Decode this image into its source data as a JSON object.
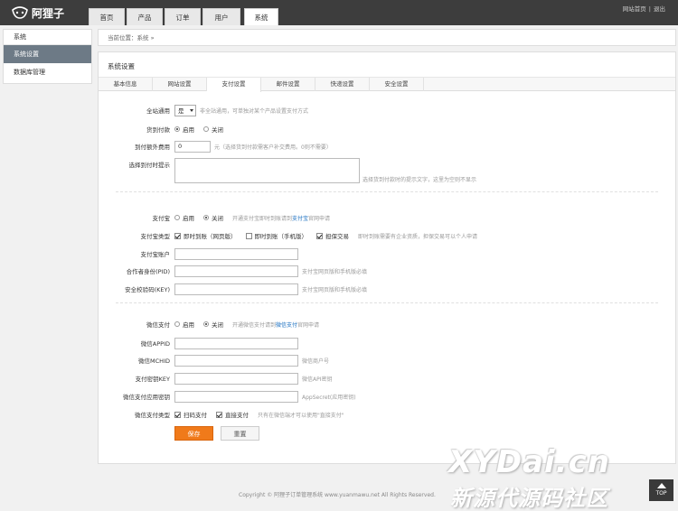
{
  "app": {
    "logo_text": "阿狸子"
  },
  "nav": {
    "tabs": [
      "首页",
      "产品",
      "订单",
      "用户",
      "系统"
    ],
    "active": "系统"
  },
  "top_links": {
    "site_home": "网站首页",
    "separator": "|",
    "logout": "退出"
  },
  "sidebar": {
    "title": "系统",
    "items": [
      "系统设置",
      "数据库管理"
    ]
  },
  "breadcrumb": "当前位置：系统 »",
  "panel": {
    "title": "系统设置",
    "tabs": [
      "基本信息",
      "网站设置",
      "支付设置",
      "邮件设置",
      "快递设置",
      "安全设置"
    ],
    "active_tab": "支付设置"
  },
  "form": {
    "global": {
      "label": "全站通用",
      "select_value": "是",
      "hint": "非全站通用，可单独对某个产品设置支付方式"
    },
    "cod": {
      "label": "货到付款",
      "enable": "启用",
      "disable": "关闭"
    },
    "cod_fee": {
      "label": "到付额外费用",
      "value": "0",
      "hint": "元（选择货到付款需客户补交费用。0则不需要）"
    },
    "cod_tip": {
      "label": "选择到付时提示",
      "hint": "选择货到付款时的提示文字，这里为空则不显示"
    },
    "alipay": {
      "label": "支付宝",
      "enable": "启用",
      "disable": "关闭",
      "hint_pre": "开通支付宝即时到账请到",
      "hint_link": "支付宝",
      "hint_post": "官网申请"
    },
    "alipay_type": {
      "label": "支付宝类型",
      "opt1": "即时到账（网页版）",
      "opt2": "即时到账（手机版）",
      "opt3": "担保交易",
      "hint": "即时到账需要有企业资质，担保交易可以个人申请"
    },
    "alipay_account": {
      "label": "支付宝账户"
    },
    "partner_id": {
      "label": "合作者身份(PID)",
      "hint": "支付宝网页版和手机版必填"
    },
    "alipay_key": {
      "label": "安全校验码(KEY)",
      "hint": "支付宝网页版和手机版必填"
    },
    "wechat": {
      "label": "微信支付",
      "enable": "启用",
      "disable": "关闭",
      "hint_pre": "开通微信支付请到",
      "hint_link": "微信支付",
      "hint_post": "官网申请"
    },
    "wechat_appid": {
      "label": "微信APPID"
    },
    "wechat_mchid": {
      "label": "微信MCHID",
      "hint": "微信商户号"
    },
    "wechat_key": {
      "label": "支付密钥KEY",
      "hint": "微信API密钥"
    },
    "wechat_secret": {
      "label": "微信支付应用密钥",
      "hint": "AppSecret(应用密钥)"
    },
    "wechat_type": {
      "label": "微信支付类型",
      "opt1": "扫码支付",
      "opt2": "直接支付",
      "hint": "只有在微信端才可以使用\"直接支付\""
    },
    "save": "保存",
    "reset": "重置"
  },
  "footer": "Copyright © 阿狸子订单管理系统 www.yuanmawu.net All Rights Reserved.",
  "watermark": {
    "line1": "XYDai.cn",
    "line2": "新源代源码社区"
  },
  "top_button": "TOP"
}
